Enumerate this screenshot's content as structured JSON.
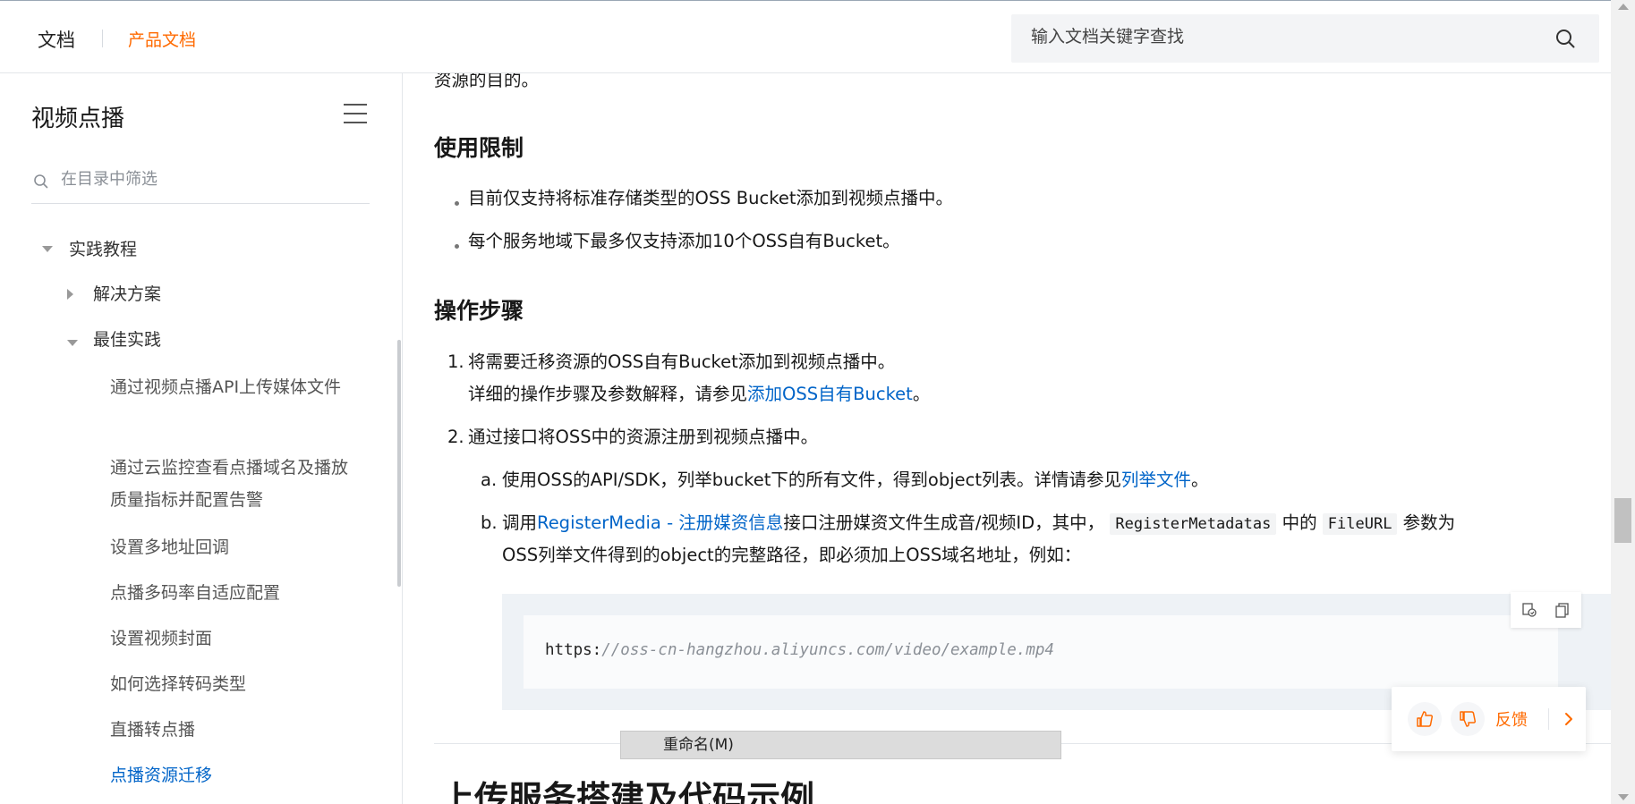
{
  "header": {
    "logo_text": "文档",
    "product_link": "产品文档",
    "search_placeholder": "输入文档关键字查找"
  },
  "sidebar": {
    "title": "视频点播",
    "filter_placeholder": "在目录中筛选",
    "group": "实践教程",
    "subgroups": [
      "解决方案",
      "最佳实践"
    ],
    "items": [
      "通过视频点播API上传媒体文件",
      "通过云监控查看点播域名及播放质量指标并配置告警",
      "设置多地址回调",
      "点播多码率自适应配置",
      "设置视频封面",
      "如何选择转码类型",
      "直播转点播",
      "点播资源迁移"
    ],
    "active_item": "点播资源迁移"
  },
  "content": {
    "intro_tail": "资源的目的。",
    "section_limit": "使用限制",
    "limit_bullets": [
      "目前仅支持将标准存储类型的OSS Bucket添加到视频点播中。",
      "每个服务地域下最多仅支持添加10个OSS自有Bucket。"
    ],
    "section_steps": "操作步骤",
    "step1_num": "1.",
    "step1": "将需要迁移资源的OSS自有Bucket添加到视频点播中。",
    "step1_detail_prefix": "详细的操作步骤及参数解释，请参见",
    "step1_detail_link": "添加OSS自有Bucket",
    "step1_detail_suffix": "。",
    "step2_num": "2.",
    "step2": "通过接口将OSS中的资源注册到视频点播中。",
    "sub_a_label": "a.",
    "sub_a_prefix": "使用OSS的API/SDK，列举bucket下的所有文件，得到object列表。详情请参见",
    "sub_a_link": "列举文件",
    "sub_a_suffix": "。",
    "sub_b_label": "b.",
    "sub_b_prefix": "调用",
    "sub_b_link": "RegisterMedia - 注册媒资信息",
    "sub_b_mid": "接口注册媒资文件生成音/视频ID，其中，",
    "sub_b_code1": "RegisterMetadatas",
    "sub_b_mid2": "中的",
    "sub_b_code2": "FileURL",
    "sub_b_suffix": "参数为",
    "sub_b_line2": "OSS列举文件得到的object的完整路径，即必须加上OSS域名地址，例如：",
    "code_scheme": "https:",
    "code_rest": "//oss-cn-hangzhou.aliyuncs.com/video/example.mp4",
    "rename_tooltip": "重命名(M)",
    "next_heading": "上传服务搭建及代码示例"
  },
  "feedback": {
    "label": "反馈"
  },
  "colors": {
    "brand_orange": "#ff6a00",
    "link_blue": "#0064c8"
  }
}
